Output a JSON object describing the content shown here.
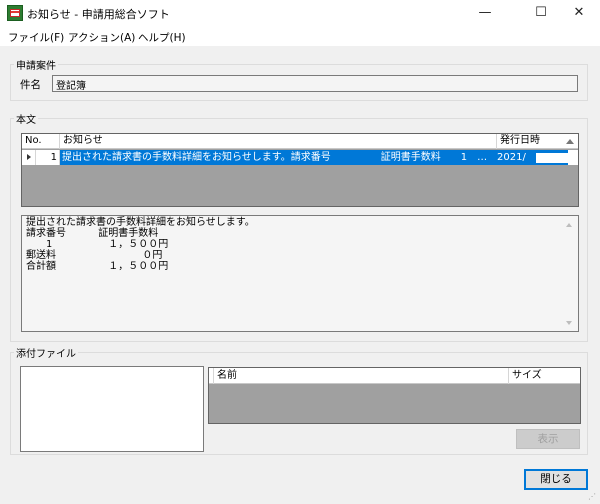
{
  "window": {
    "title": "お知らせ - 申請用総合ソフト",
    "controls": {
      "minimize": "—",
      "maximize": "☐",
      "close": "✕"
    }
  },
  "menu": {
    "items": [
      "ファイル(F)",
      "アクション(A)",
      "ヘルプ(H)"
    ]
  },
  "case_section": {
    "label": "申請案件",
    "subject_label": "件名",
    "subject_value": "登記簿"
  },
  "body_section": {
    "label": "本文",
    "columns": [
      "No.",
      "お知らせ",
      "発行日時"
    ],
    "row": {
      "no": "1",
      "text": "提出された請求書の手数料詳細をお知らせします。請求番号　　　　　証明書手数料　　1　…",
      "date": "2021/"
    },
    "body_text": "提出された請求書の手数料詳細をお知らせします。\n請求番号\t\t証明書手数料\n　　1\t\t　１，５００円\n郵送料\t\t\t　　０円\n合計額\t\t　１，５００円"
  },
  "attachments_section": {
    "label": "添付ファイル",
    "columns": [
      "名前",
      "サイズ"
    ]
  },
  "buttons": {
    "show": "表示",
    "close": "閉じる"
  },
  "icons": {
    "app": "app-icon",
    "sort": "sort-up-icon",
    "row_marker": "row-pointer-icon",
    "scroll_up": "scroll-up-icon",
    "scroll_down": "scroll-down-icon"
  },
  "colors": {
    "selection": "#0078d7",
    "grid_background": "#a0a0a0",
    "window": "#f0f0f0"
  }
}
